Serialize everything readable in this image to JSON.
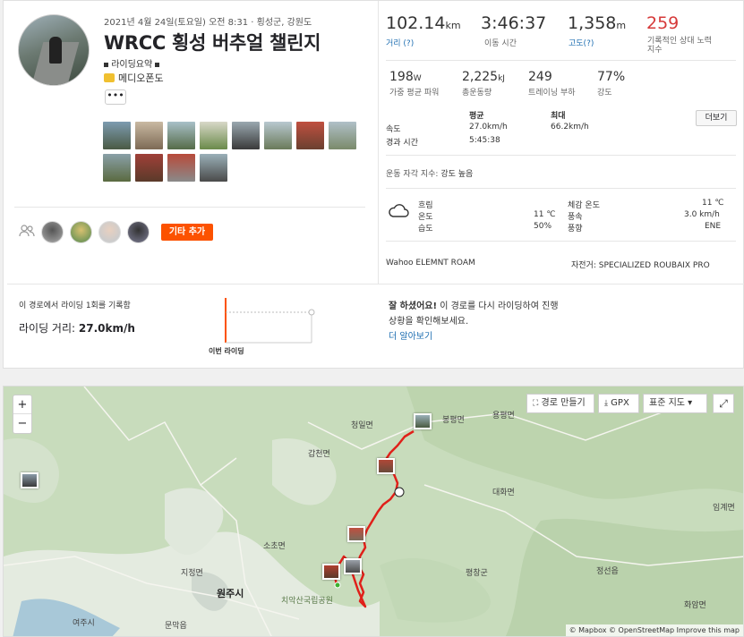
{
  "activity": {
    "date_location": "2021년 4월 24일(토요일) 오전 8:31 · 횡성군, 강원도",
    "title": "WRCC 횡성 버추얼 챌린지",
    "summary_label": "라이딩요약",
    "tag_label": "메디오폰도",
    "more_dots": "•••"
  },
  "athletes": {
    "add_button": "기타 추가"
  },
  "stats_primary": [
    {
      "value": "102.14",
      "unit": "km",
      "label": "거리 (?)",
      "link": true
    },
    {
      "value": "3:46:37",
      "unit": "",
      "label": "이동 시간",
      "link": false
    },
    {
      "value": "1,358",
      "unit": "m",
      "label": "고도(?)",
      "link": true
    },
    {
      "value": "259",
      "unit": "",
      "label": "기록적인 상대 노력 지수",
      "link": false
    }
  ],
  "stats_secondary": [
    {
      "value": "198",
      "unit": "W",
      "label": "가중 평균 파워"
    },
    {
      "value": "2,225",
      "unit": "kJ",
      "label": "총운동량"
    },
    {
      "value": "249",
      "unit": "",
      "label": "트레이닝 부하"
    },
    {
      "value": "77%",
      "unit": "",
      "label": "강도"
    }
  ],
  "details": {
    "col_avg": "평균",
    "col_max": "최대",
    "more_button": "더보기",
    "rows": [
      {
        "label": "속도",
        "avg": "27.0km/h",
        "max": "66.2km/h"
      },
      {
        "label": "경과 시간",
        "avg": "5:45:38",
        "max": ""
      }
    ],
    "perceived_label": "운동 자각 지수:",
    "perceived_value": "강도 높음"
  },
  "weather": {
    "left": [
      {
        "label": "흐림",
        "value": ""
      },
      {
        "label": "온도",
        "value": "11 ℃"
      },
      {
        "label": "습도",
        "value": "50%"
      }
    ],
    "right": [
      {
        "label": "체감 온도",
        "value": "11 ℃"
      },
      {
        "label": "풍속",
        "value": "3.0 km/h"
      },
      {
        "label": "풍향",
        "value": "ENE"
      }
    ]
  },
  "devices": {
    "device": "Wahoo ELEMNT ROAM",
    "bike": "자전거: SPECIALIZED ROUBAIX PRO"
  },
  "segment": {
    "records_line": "이 경로에서 라이딩 1회를 기록함",
    "distance_label": "라이딩 거리:",
    "distance_value": "27.0km/h",
    "chart_label": "이번 라이딩",
    "promo_bold": "잘 하셨어요!",
    "promo_text": " 이 경로를 다시 라이딩하여 진행 상황을 확인해보세요.",
    "promo_link": "더 알아보기"
  },
  "map": {
    "zoom_in": "+",
    "zoom_out": "−",
    "make_route": "경로 만들기",
    "gpx": "GPX",
    "map_style": "표준 지도 ▾",
    "attribution": "© Mapbox © OpenStreetMap  Improve this map",
    "places": {
      "p1": "청일면",
      "p2": "봉평면",
      "p3": "용평면",
      "p4": "갑천면",
      "p5": "대화면",
      "p6": "임계면",
      "p7": "소초면",
      "p8": "지정면",
      "p9": "평창군",
      "p10": "정선읍",
      "p11": "원주시",
      "p12": "치악산국립공원",
      "p13": "여주시",
      "p14": "문막읍",
      "p15": "화암면"
    }
  },
  "colors": {
    "accent": "#fc5200",
    "link": "#1f6fb2",
    "suffer": "#d63a3a",
    "route": "#e0201a"
  }
}
